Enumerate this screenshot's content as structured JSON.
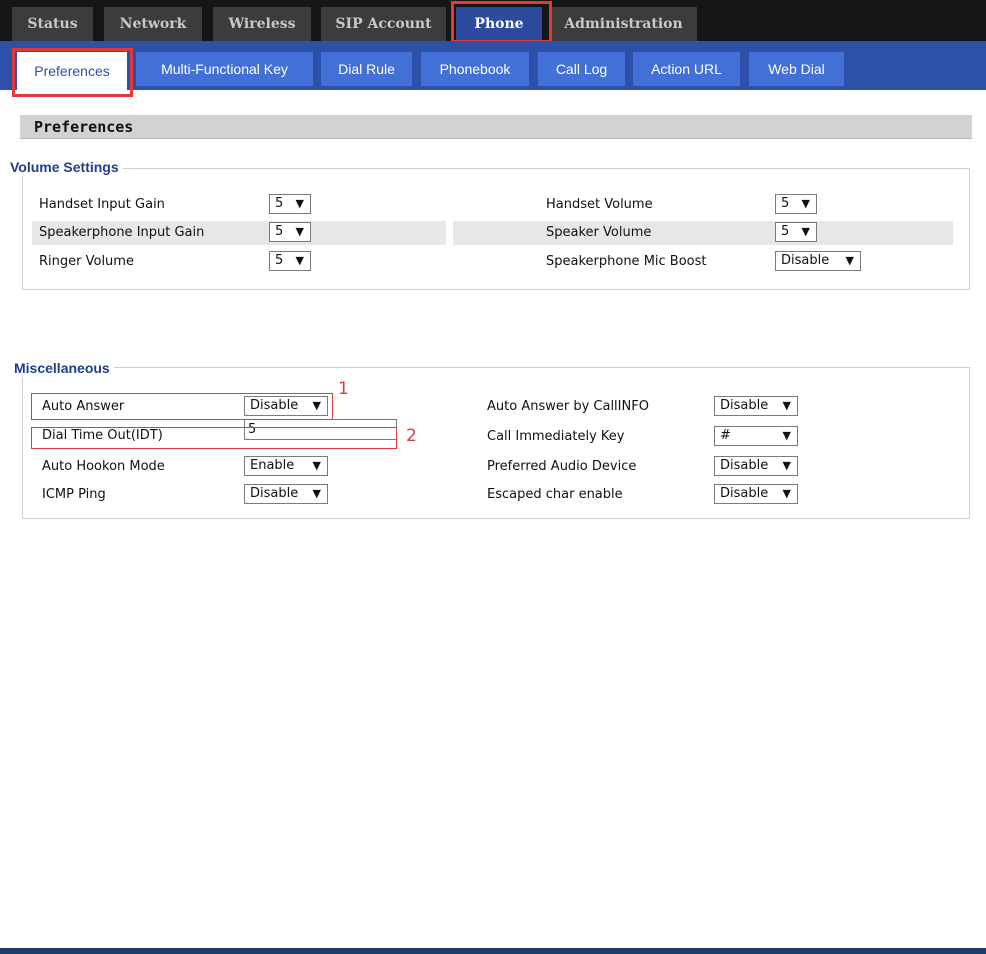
{
  "top_tabs": [
    "Status",
    "Network",
    "Wireless",
    "SIP Account",
    "Phone",
    "Administration"
  ],
  "sub_tabs": [
    "Preferences",
    "Multi-Functional Key",
    "Dial Rule",
    "Phonebook",
    "Call Log",
    "Action URL",
    "Web Dial"
  ],
  "page_title": "Preferences",
  "volume": {
    "legend": "Volume Settings",
    "rows": [
      {
        "left_label": "Handset Input Gain",
        "left_value": "5",
        "right_label": "Handset Volume",
        "right_value": "5"
      },
      {
        "left_label": "Speakerphone Input Gain",
        "left_value": "5",
        "right_label": "Speaker Volume",
        "right_value": "5"
      },
      {
        "left_label": "Ringer Volume",
        "left_value": "5",
        "right_label": "Speakerphone Mic Boost",
        "right_value": "Disable"
      }
    ]
  },
  "misc": {
    "legend": "Miscellaneous",
    "rows": [
      {
        "left_label": "Auto Answer",
        "left_value": "Disable",
        "right_label": "Auto Answer by CallINFO",
        "right_value": "Disable"
      },
      {
        "left_label": "Dial Time Out(IDT)",
        "left_value": "5",
        "right_label": "Call Immediately Key",
        "right_value": "#"
      },
      {
        "left_label": "Auto Hookon Mode",
        "left_value": "Enable",
        "right_label": "Preferred Audio Device",
        "right_value": "Disable"
      },
      {
        "left_label": "ICMP Ping",
        "left_value": "Disable",
        "right_label": "Escaped char enable",
        "right_value": "Disable"
      }
    ]
  },
  "annotations": [
    "1",
    "2"
  ],
  "colors": {
    "accent": "#2d51a8",
    "highlight": "#e03a3a",
    "legend": "#1f3f8c"
  }
}
